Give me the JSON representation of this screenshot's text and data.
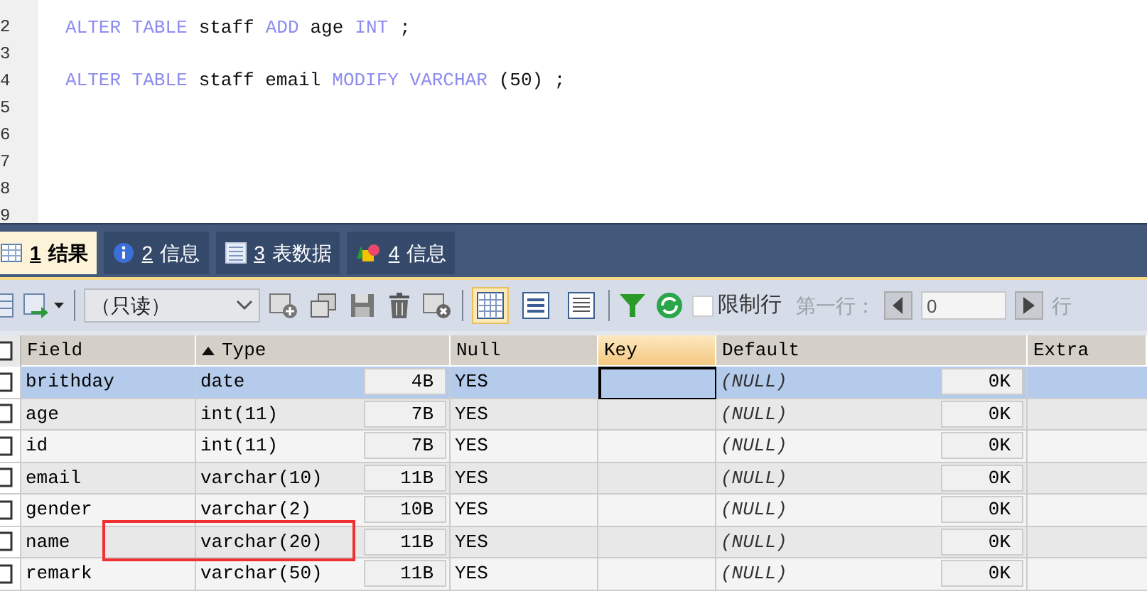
{
  "editor": {
    "lines": [
      {
        "number": "2",
        "tokens": [
          {
            "kind": "keyword",
            "text": "ALTER TABLE"
          },
          {
            "kind": "plain",
            "text": "staff"
          },
          {
            "kind": "keyword",
            "text": "ADD"
          },
          {
            "kind": "plain",
            "text": "age"
          },
          {
            "kind": "keyword",
            "text": "INT"
          },
          {
            "kind": "plain",
            "text": ";"
          }
        ]
      },
      {
        "number": "3"
      },
      {
        "number": "4",
        "tokens": [
          {
            "kind": "keyword",
            "text": "ALTER TABLE"
          },
          {
            "kind": "plain",
            "text": "staff email"
          },
          {
            "kind": "keyword",
            "text": "MODIFY VARCHAR"
          },
          {
            "kind": "plain",
            "text": "(50) ;"
          }
        ]
      },
      {
        "number": "5"
      },
      {
        "number": "6"
      },
      {
        "number": "7"
      },
      {
        "number": "8"
      },
      {
        "number": "9"
      }
    ]
  },
  "tabs": [
    {
      "hotkey": "1",
      "label": "结果",
      "selected": true
    },
    {
      "hotkey": "2",
      "label": "信息",
      "selected": false
    },
    {
      "hotkey": "3",
      "label": "表数据",
      "selected": false
    },
    {
      "hotkey": "4",
      "label": "信息",
      "selected": false
    }
  ],
  "toolbar": {
    "mode_dropdown": "（只读）",
    "view_buttons": [
      {
        "selected": true
      },
      {
        "selected": false
      },
      {
        "selected": false
      }
    ],
    "limit_rows": {
      "label": "限制行",
      "checked": false
    },
    "first_row_label": "第一行：",
    "first_row_value": "0",
    "row_count_label": "行"
  },
  "table": {
    "select_all_checked": false,
    "columns": [
      {
        "label": "Field",
        "sort_ascending": false,
        "active": false
      },
      {
        "label": "Type",
        "sort_ascending": true,
        "active": false
      },
      {
        "label": "Null",
        "sort_ascending": false,
        "active": false
      },
      {
        "label": "Key",
        "sort_ascending": false,
        "active": true
      },
      {
        "label": "Default",
        "sort_ascending": false,
        "active": false
      },
      {
        "label": "Extra",
        "sort_ascending": false,
        "active": false
      }
    ],
    "rows": [
      {
        "selected": true,
        "checked": false,
        "field": "brithday",
        "type": "date",
        "type_size": "4B",
        "null": "YES",
        "default": "(NULL)",
        "default_size": "0K"
      },
      {
        "selected": false,
        "checked": false,
        "field": "age",
        "type": "int(11)",
        "type_size": "7B",
        "null": "YES",
        "default": "(NULL)",
        "default_size": "0K"
      },
      {
        "selected": false,
        "checked": false,
        "field": "id",
        "type": "int(11)",
        "type_size": "7B",
        "null": "YES",
        "default": "(NULL)",
        "default_size": "0K"
      },
      {
        "selected": false,
        "checked": false,
        "field": "email",
        "type": "varchar(10)",
        "type_size": "11B",
        "null": "YES",
        "default": "(NULL)",
        "default_size": "0K"
      },
      {
        "selected": false,
        "checked": false,
        "field": "gender",
        "type": "varchar(2)",
        "type_size": "10B",
        "null": "YES",
        "default": "(NULL)",
        "default_size": "0K"
      },
      {
        "selected": false,
        "checked": false,
        "field": "name",
        "type": "varchar(20)",
        "type_size": "11B",
        "null": "YES",
        "default": "(NULL)",
        "default_size": "0K"
      },
      {
        "selected": false,
        "checked": false,
        "field": "remark",
        "type": "varchar(50)",
        "type_size": "11B",
        "null": "YES",
        "default": "(NULL)",
        "default_size": "0K"
      }
    ]
  }
}
